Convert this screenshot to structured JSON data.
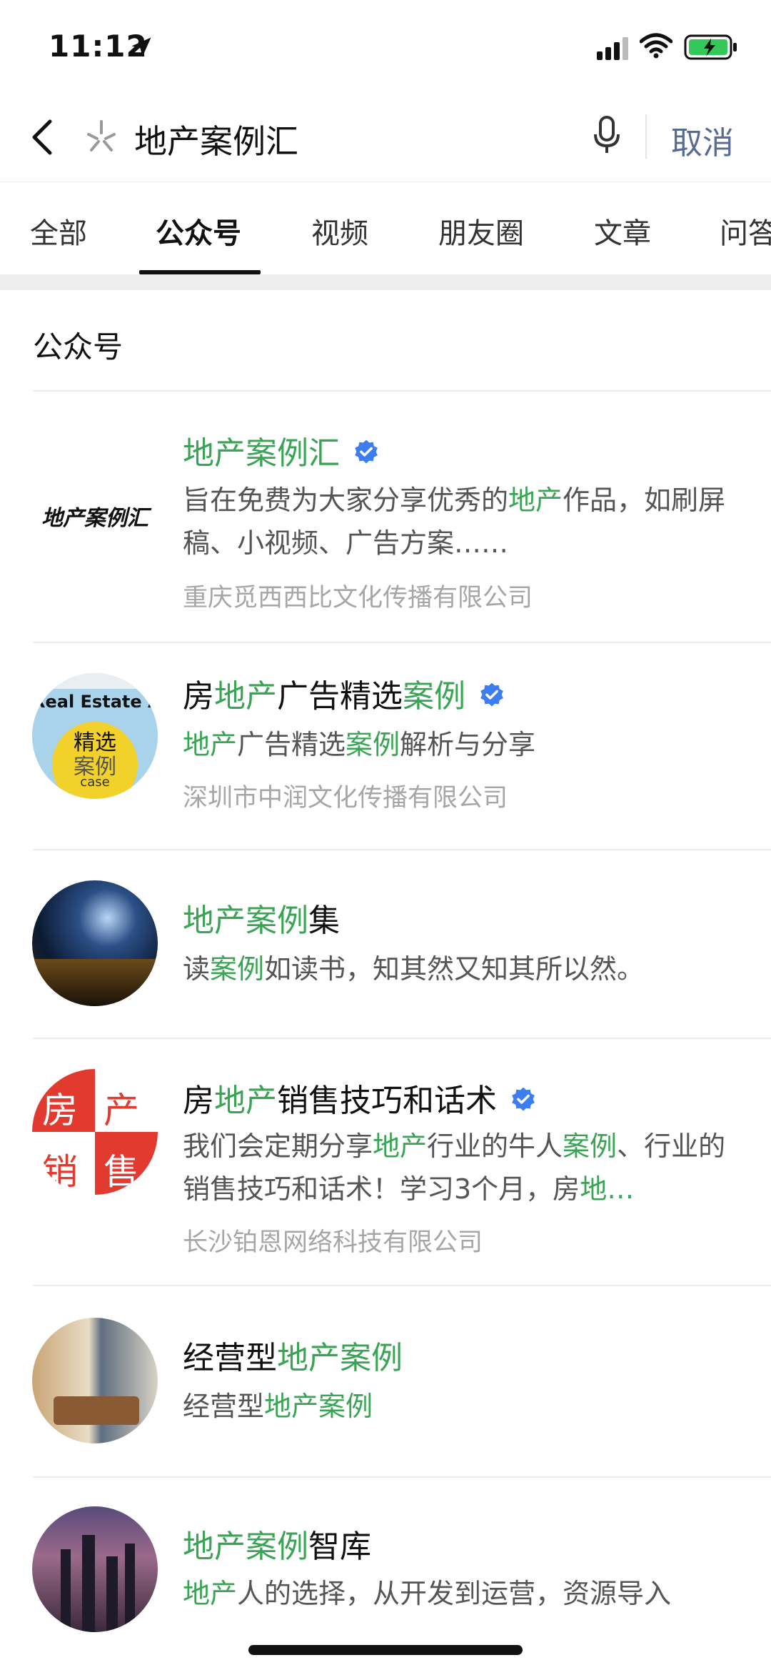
{
  "status": {
    "time": "11:12"
  },
  "search": {
    "query": "地产案例汇",
    "cancel": "取消"
  },
  "tabs": [
    "全部",
    "公众号",
    "视频",
    "朋友圈",
    "文章",
    "问答"
  ],
  "section": {
    "title": "公众号"
  },
  "results": [
    {
      "avatar_text": "地产案例汇",
      "name_hl": "地产案例汇",
      "name_rest": "",
      "verified": true,
      "desc": [
        [
          "旨在免费为大家分享优秀的",
          ""
        ],
        [
          "地产",
          "hl"
        ],
        [
          "作品，如刷屏稿、小视频、广告方案……",
          ""
        ]
      ],
      "company": "重庆觅西西比文化传播有限公司"
    },
    {
      "avatar_lines": [
        "Real Estate Ac",
        "精选",
        "案例",
        "case"
      ],
      "name_parts": [
        [
          "房",
          ""
        ],
        [
          "地产",
          "hl"
        ],
        [
          "广告精选",
          ""
        ],
        [
          "案例",
          "hl"
        ]
      ],
      "verified": true,
      "desc": [
        [
          "地产",
          "hl"
        ],
        [
          "广告精选",
          ""
        ],
        [
          "案例",
          "hl"
        ],
        [
          "解析与分享",
          ""
        ]
      ],
      "company": "深圳市中润文化传播有限公司"
    },
    {
      "name_parts": [
        [
          "地产案例",
          "hl"
        ],
        [
          "集",
          ""
        ]
      ],
      "verified": false,
      "desc": [
        [
          "读",
          ""
        ],
        [
          "案例",
          "hl"
        ],
        [
          "如读书，知其然又知其所以然。",
          ""
        ]
      ],
      "company": ""
    },
    {
      "avatar_chars": [
        "房",
        "产",
        "销",
        "售"
      ],
      "name_parts": [
        [
          "房",
          ""
        ],
        [
          "地产",
          "hl"
        ],
        [
          "销售技巧和话术",
          ""
        ]
      ],
      "verified": true,
      "desc": [
        [
          "我们会定期分享",
          ""
        ],
        [
          "地产",
          "hl"
        ],
        [
          "行业的牛人",
          ""
        ],
        [
          "案例",
          "hl"
        ],
        [
          "、行业的销售技巧和话术！学习3个月，房",
          ""
        ],
        [
          "地…",
          "hl"
        ]
      ],
      "company": "长沙铂恩网络科技有限公司"
    },
    {
      "name_parts": [
        [
          "经营型",
          ""
        ],
        [
          "地产案例",
          "hl"
        ]
      ],
      "verified": false,
      "desc": [
        [
          "经营型",
          ""
        ],
        [
          "地产案例",
          "hl"
        ]
      ],
      "company": ""
    },
    {
      "name_parts": [
        [
          "地产案例",
          "hl"
        ],
        [
          "智库",
          ""
        ]
      ],
      "verified": false,
      "desc": [
        [
          "地产",
          "hl"
        ],
        [
          "人的选择，从开发到运营，资源导入",
          ""
        ]
      ],
      "company": ""
    }
  ],
  "colors": {
    "highlight": "#39a454",
    "link": "#576b95",
    "verified": "#3d7df2"
  }
}
